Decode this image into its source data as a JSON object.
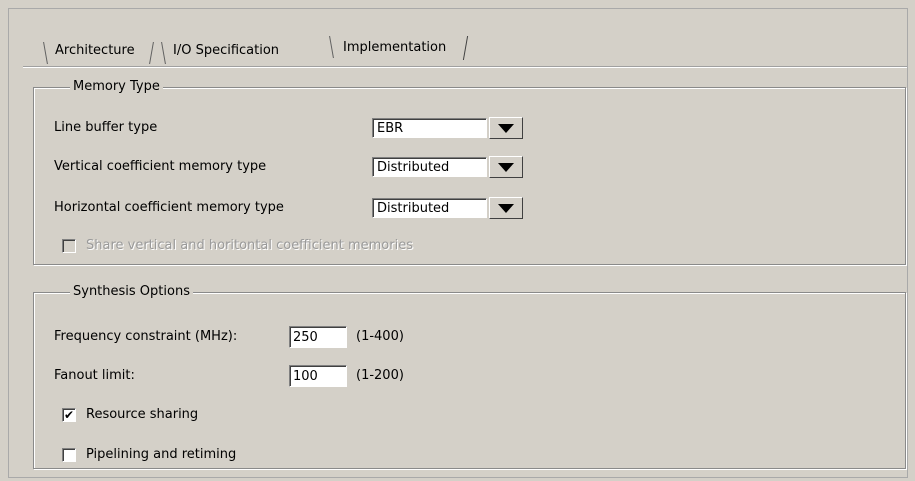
{
  "tabs": [
    {
      "label": "Architecture"
    },
    {
      "label": "I/O Specification"
    },
    {
      "label": "Implementation"
    }
  ],
  "memory_type": {
    "title": "Memory Type",
    "line_buffer": {
      "label": "Line buffer type",
      "value": "EBR"
    },
    "vertical_coeff": {
      "label": "Vertical coefficient memory type",
      "value": "Distributed"
    },
    "horizontal_coeff": {
      "label": "Horizontal coefficient memory type",
      "value": "Distributed"
    },
    "share_checkbox": {
      "label": "Share vertical and horitontal coefficient memories",
      "checked": false,
      "enabled": false
    }
  },
  "synthesis": {
    "title": "Synthesis Options",
    "frequency": {
      "label": "Frequency constraint (MHz):",
      "value": "250",
      "range": "(1-400)"
    },
    "fanout": {
      "label": "Fanout limit:",
      "value": "100",
      "range": "(1-200)"
    },
    "resource_sharing": {
      "label": "Resource sharing",
      "checked": true,
      "mark": "✔"
    },
    "pipelining": {
      "label": "Pipelining and retiming",
      "checked": false
    }
  }
}
